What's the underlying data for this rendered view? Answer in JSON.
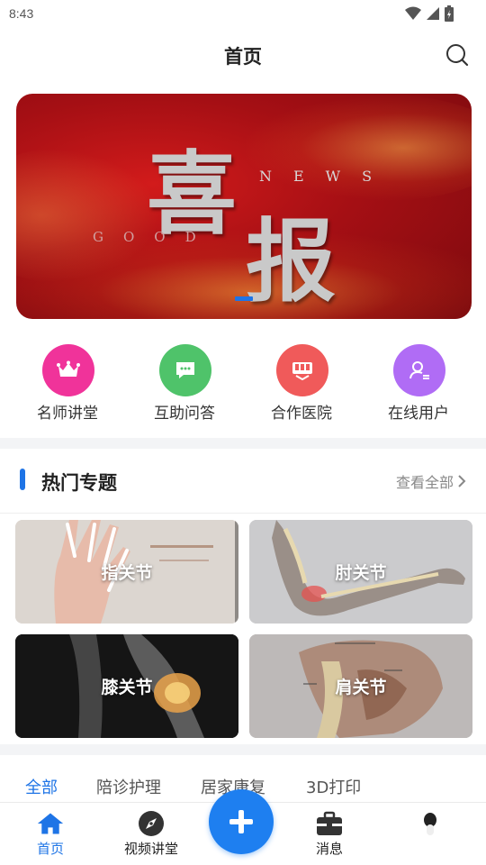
{
  "status_bar": {
    "time": "8:43"
  },
  "header": {
    "title": "首页",
    "search_icon": "search-icon"
  },
  "banner": {
    "title_char_1": "喜",
    "title_char_2": "报",
    "news_text": "NEWS",
    "good_text": "GOOD",
    "page_indicator": "1"
  },
  "quick_links": [
    {
      "label": "名师讲堂",
      "icon": "crown-icon",
      "color": "#f0339a"
    },
    {
      "label": "互助问答",
      "icon": "chat-bubble-icon",
      "color": "#4fc36a"
    },
    {
      "label": "合作医院",
      "icon": "hospital-icon",
      "color": "#f05a5a"
    },
    {
      "label": "在线用户",
      "icon": "user-list-icon",
      "color": "#b06cf5"
    }
  ],
  "hot_topics": {
    "title": "热门专题",
    "view_all": "查看全部",
    "cards": [
      {
        "label": "指关节",
        "image": "hand-bones-image"
      },
      {
        "label": "肘关节",
        "image": "elbow-anatomy-image"
      },
      {
        "label": "膝关节",
        "image": "knee-xray-image"
      },
      {
        "label": "肩关节",
        "image": "shoulder-anatomy-image"
      }
    ]
  },
  "category_tabs": [
    {
      "label": "全部",
      "active": true
    },
    {
      "label": "陪诊护理",
      "active": false
    },
    {
      "label": "居家康复",
      "active": false
    },
    {
      "label": "3D打印",
      "active": false
    }
  ],
  "bottom_nav": {
    "items": [
      {
        "label": "首页",
        "icon": "home-icon",
        "active": true
      },
      {
        "label": "视频讲堂",
        "icon": "compass-icon",
        "active": false
      },
      {
        "label": "消息",
        "icon": "briefcase-icon",
        "active": false
      },
      {
        "label": "",
        "icon": "profile-icon",
        "active": false
      }
    ],
    "fab_icon": "plus-icon"
  },
  "colors": {
    "accent": "#1e74e6",
    "banner_red": "#b5121b"
  }
}
